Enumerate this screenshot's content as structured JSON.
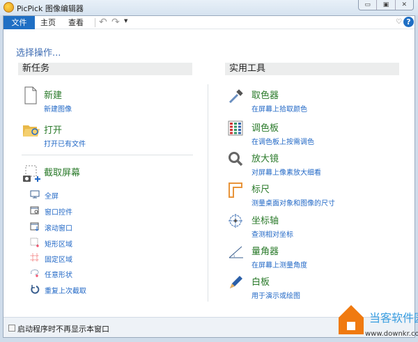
{
  "window": {
    "title": "PicPick 图像编辑器",
    "minimize": "▭",
    "restore": "▣",
    "close": "✕"
  },
  "menu": {
    "file": "文件",
    "home": "主页",
    "view": "查看",
    "undo": "↶",
    "redo": "↷",
    "dropdown": "▼",
    "favorite": "♡",
    "help": "?"
  },
  "prompt": "选择操作...",
  "left": {
    "header": "新任务",
    "new": {
      "title": "新建",
      "sub": "新建图像"
    },
    "open": {
      "title": "打开",
      "sub": "打开已有文件"
    },
    "capture": {
      "title": "截取屏幕",
      "items": [
        {
          "label": "全屏",
          "icon": "monitor-icon"
        },
        {
          "label": "窗口控件",
          "icon": "window-control-icon"
        },
        {
          "label": "滚动窗口",
          "icon": "scroll-window-icon"
        },
        {
          "label": "矩形区域",
          "icon": "rect-region-icon"
        },
        {
          "label": "固定区域",
          "icon": "fixed-region-icon"
        },
        {
          "label": "任意形状",
          "icon": "freeform-icon"
        },
        {
          "label": "重复上次截取",
          "icon": "repeat-icon"
        }
      ]
    }
  },
  "right": {
    "header": "实用工具",
    "tools": [
      {
        "title": "取色器",
        "sub": "在屏幕上拾取颜色",
        "icon": "eyedropper-icon"
      },
      {
        "title": "调色板",
        "sub": "在调色板上按需调色",
        "icon": "palette-icon"
      },
      {
        "title": "放大镜",
        "sub": "对屏幕上像素放大细看",
        "icon": "magnifier-icon"
      },
      {
        "title": "标尺",
        "sub": "测量桌面对象和图像的尺寸",
        "icon": "ruler-icon"
      },
      {
        "title": "坐标轴",
        "sub": "查测相对坐标",
        "icon": "crosshair-icon"
      },
      {
        "title": "量角器",
        "sub": "在屏幕上测量角度",
        "icon": "protractor-icon"
      },
      {
        "title": "白板",
        "sub": "用于演示或绘图",
        "icon": "pen-icon"
      }
    ]
  },
  "footer": {
    "checkbox_label": "启动程序时不再显示本窗口",
    "checked": false
  },
  "watermark": {
    "name": "当客软件园",
    "url": "www.downkr.com"
  }
}
